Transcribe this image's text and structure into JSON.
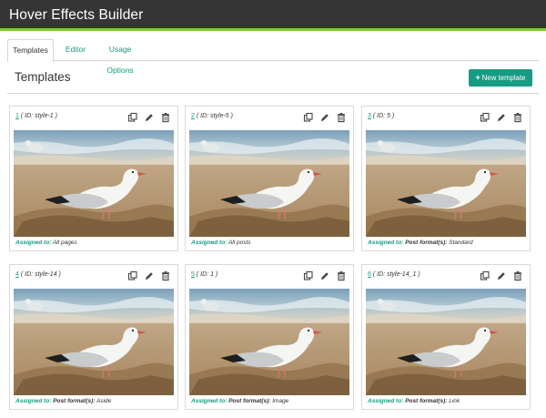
{
  "app": {
    "title": "Hover Effects Builder"
  },
  "tabs": [
    {
      "label": "Templates",
      "active": true
    },
    {
      "label": "Editor",
      "active": false
    },
    {
      "label": "Usage Options",
      "active": false
    }
  ],
  "main": {
    "title": "Templates",
    "new_button": "New template",
    "new_icon": "plus-icon"
  },
  "colors": {
    "accent": "#169b84",
    "topbar": "#353535",
    "topbar_border": "#7ac943"
  },
  "cards": [
    {
      "num": "1",
      "id": "( ID: style-1 )",
      "assigned_label": "Assigned to:",
      "assigned_bold": "",
      "assigned_value": "All pages"
    },
    {
      "num": "2",
      "id": "( ID: style-5 )",
      "assigned_label": "Assigned to:",
      "assigned_bold": "",
      "assigned_value": "All posts"
    },
    {
      "num": "3",
      "id": "( ID: 5 )",
      "assigned_label": "Assigned to:",
      "assigned_bold": "Post format(s):",
      "assigned_value": "Standard"
    },
    {
      "num": "4",
      "id": "( ID: style-14 )",
      "assigned_label": "Assigned to:",
      "assigned_bold": "Post format(s):",
      "assigned_value": "Aside"
    },
    {
      "num": "5",
      "id": "( ID: 1 )",
      "assigned_label": "Assigned to:",
      "assigned_bold": "Post format(s):",
      "assigned_value": "Image"
    },
    {
      "num": "6",
      "id": "( ID: style-14_1 )",
      "assigned_label": "Assigned to:",
      "assigned_bold": "Post format(s):",
      "assigned_value": "Link"
    }
  ],
  "card_icons": [
    "copy-icon",
    "pencil-icon",
    "trash-icon"
  ]
}
